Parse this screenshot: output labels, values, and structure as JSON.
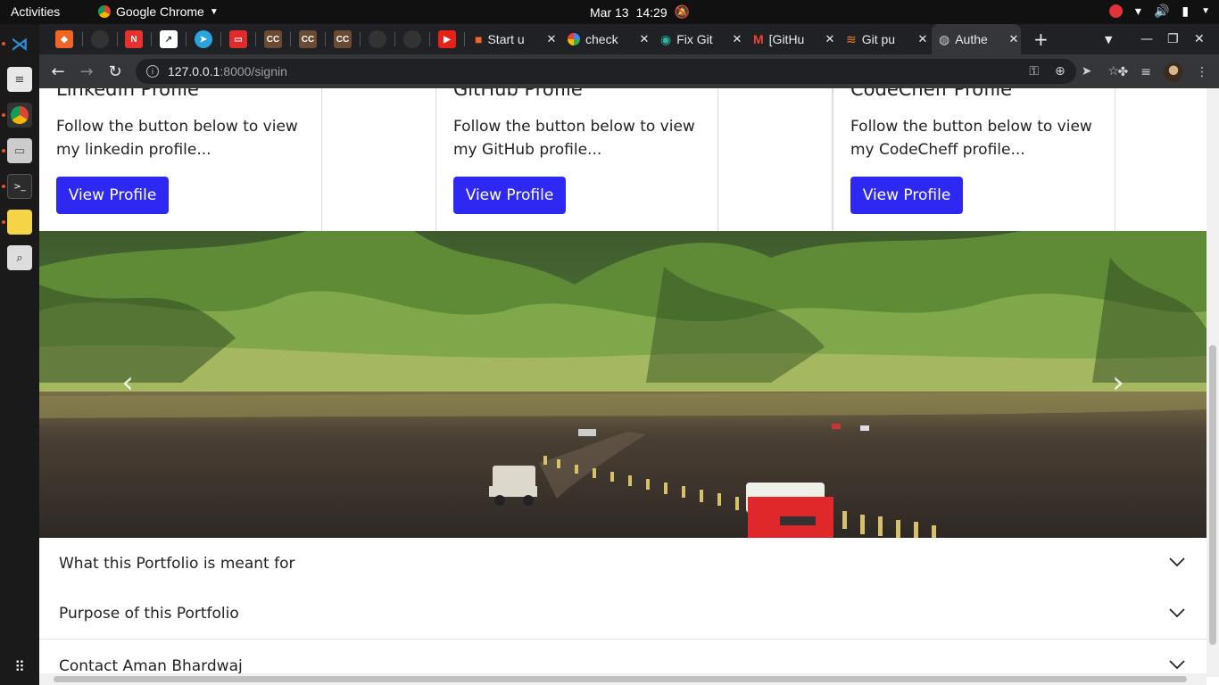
{
  "topbar": {
    "activities": "Activities",
    "app_name": "Google Chrome",
    "date": "Mar 13",
    "time": "14:29"
  },
  "dock": {
    "apps": [
      "vscode-icon",
      "gedit-icon",
      "chrome-icon",
      "files-icon",
      "terminal-icon",
      "notes-icon",
      "search-tool-icon",
      "app-grid-icon"
    ]
  },
  "tabs": {
    "pinned": [
      "brave-icon",
      "github-icon",
      "n-icon",
      "chart-icon",
      "telegram-icon",
      "oracle-icon",
      "cc-icon",
      "cc-icon",
      "cc-icon",
      "github-icon",
      "github-icon",
      "youtube-icon"
    ],
    "labeled": [
      {
        "title": "Start u",
        "icon": "gift-icon"
      },
      {
        "title": "check",
        "icon": "google-icon"
      },
      {
        "title": "Fix Git",
        "icon": "eye-icon"
      },
      {
        "title": "[GitHu",
        "icon": "gmail-icon"
      },
      {
        "title": "Git pu",
        "icon": "stackoverflow-icon"
      },
      {
        "title": "Authe",
        "icon": "globe-icon"
      }
    ],
    "cc_text": "CC"
  },
  "address": {
    "host": "127.0.0.1",
    "path": ":8000/signin"
  },
  "cards": [
    {
      "title": "LinkedIn Profile",
      "text": "Follow the button below to view my linkedin profile...",
      "button": "View Profile"
    },
    {
      "title": "GitHub Profile",
      "text": "Follow the button below to view my GitHub profile...",
      "button": "View Profile"
    },
    {
      "title": "CodeCheff Profile",
      "text": "Follow the button below to view my CodeCheff profile...",
      "button": "View Profile"
    }
  ],
  "carousel": {
    "prev": "‹",
    "next": "›"
  },
  "accordion": [
    {
      "title": "What this Portfolio is meant for"
    },
    {
      "title": "Purpose of this Portfolio"
    },
    {
      "title": "Contact Aman Bhardwaj"
    }
  ],
  "colors": {
    "button": "#2d28f2",
    "tabstrip": "#202124",
    "toolbar": "#35363a"
  }
}
